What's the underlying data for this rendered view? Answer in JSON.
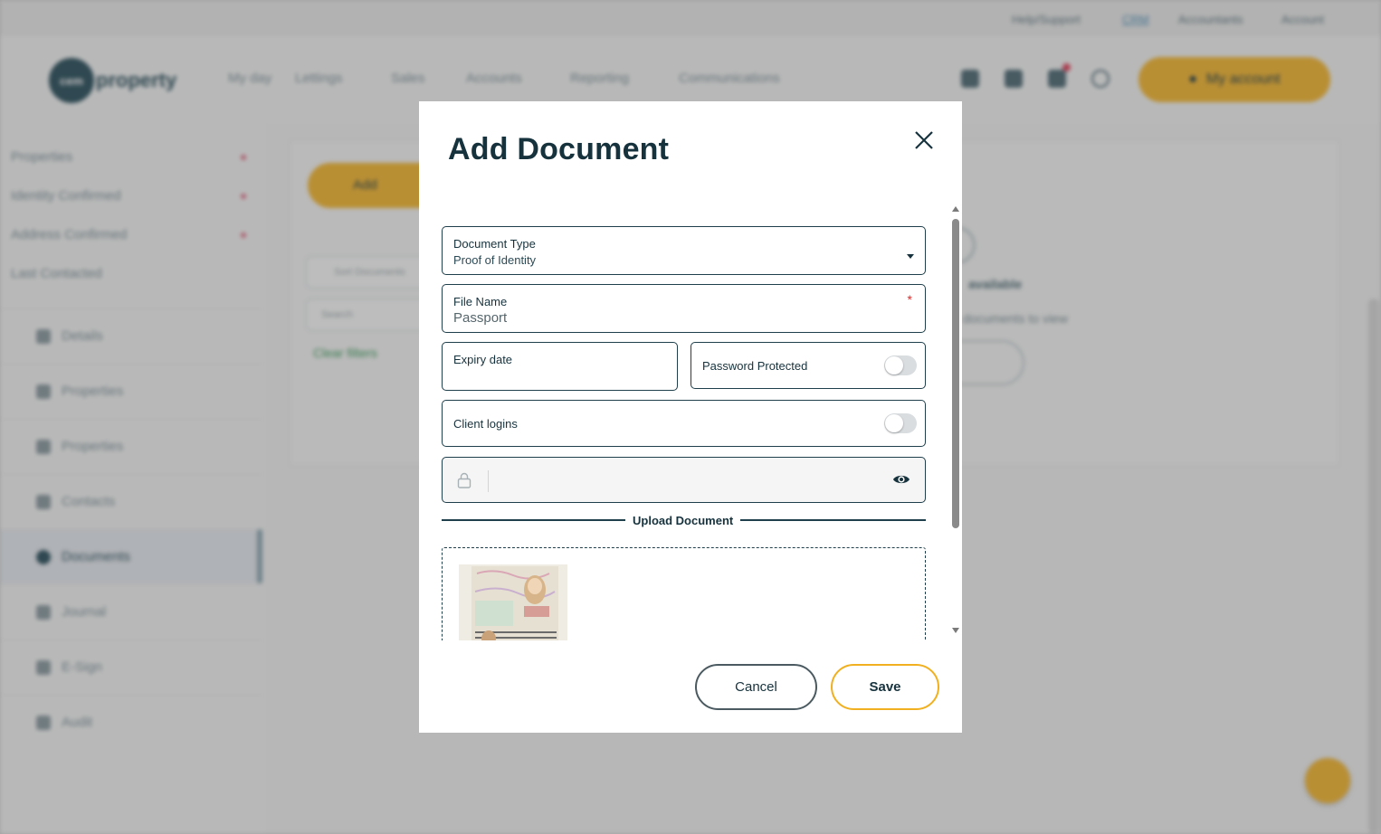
{
  "background": {
    "top_links": [
      "Help/Support",
      "CRM",
      "Accountants",
      "Account"
    ],
    "top_active": "CRM",
    "logo_text": "cem",
    "logo_word": "property",
    "nav": [
      "My day",
      "Lettings",
      "Sales",
      "Accounts",
      "Reporting",
      "Communications"
    ],
    "account_label": "My account",
    "sidebar_top": [
      "Properties",
      "Identity Confirmed",
      "Address Confirmed",
      "Last Contacted"
    ],
    "sidebar_items": [
      "Details",
      "Properties",
      "Properties",
      "Contacts",
      "Documents",
      "Journal",
      "E-Sign",
      "Audit"
    ],
    "sidebar_active": "Documents",
    "add_button": "Add",
    "search_placeholder": "Sort Documents",
    "search2_placeholder": "Search",
    "clear_filters": "Clear filters",
    "empty_title": "available",
    "empty_sub": "documents to view",
    "colors": {
      "accent": "#f5b731",
      "brand": "#2a4f5c"
    }
  },
  "modal": {
    "title": "Add Document",
    "document_type": {
      "label": "Document Type",
      "value": "Proof of Identity"
    },
    "file_name": {
      "label": "File Name",
      "value": "Passport",
      "required_mark": "*"
    },
    "expiry": {
      "label": "Expiry date",
      "value": ""
    },
    "password_protected": {
      "label": "Password Protected",
      "on": false
    },
    "client_logins": {
      "label": "Client logins",
      "on": false
    },
    "password": {
      "value": ""
    },
    "upload_label": "Upload Document",
    "cancel_label": "Cancel",
    "save_label": "Save",
    "colors": {
      "border": "#1e3f4b",
      "save_border": "#f0b01f",
      "required": "#e02a2a"
    }
  }
}
